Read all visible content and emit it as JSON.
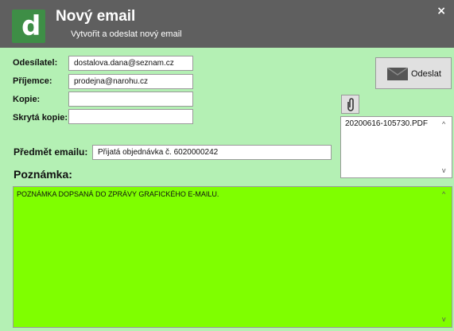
{
  "header": {
    "logo_letter": "d",
    "title": "Nový email",
    "subtitle": "Vytvořit a odeslat nový email",
    "close_glyph": "×"
  },
  "form": {
    "sender_label": "Odesílatel:",
    "sender_value": "dostalova.dana@seznam.cz",
    "recipient_label": "Příjemce:",
    "recipient_value": "prodejna@narohu.cz",
    "cc_label": "Kopie:",
    "cc_value": "",
    "bcc_label": "Skrytá kopie:",
    "bcc_value": "",
    "subject_label": "Předmět emailu:",
    "subject_value": "Přijatá objednávka č. 6020000242"
  },
  "actions": {
    "send_label": "Odeslat",
    "send_icon": "envelope-icon",
    "attach_icon": "paperclip-icon"
  },
  "attachments": {
    "files": [
      "20200616-105730.PDF"
    ]
  },
  "note": {
    "label": "Poznámka:",
    "text": "POZNÁMKA DOPSANÁ DO ZPRÁVY GRAFICKÉHO E-MAILU."
  },
  "colors": {
    "background": "#b4f0b4",
    "header": "#5f5f5f",
    "logo": "#3e8e46",
    "note_background": "#7fff00"
  }
}
